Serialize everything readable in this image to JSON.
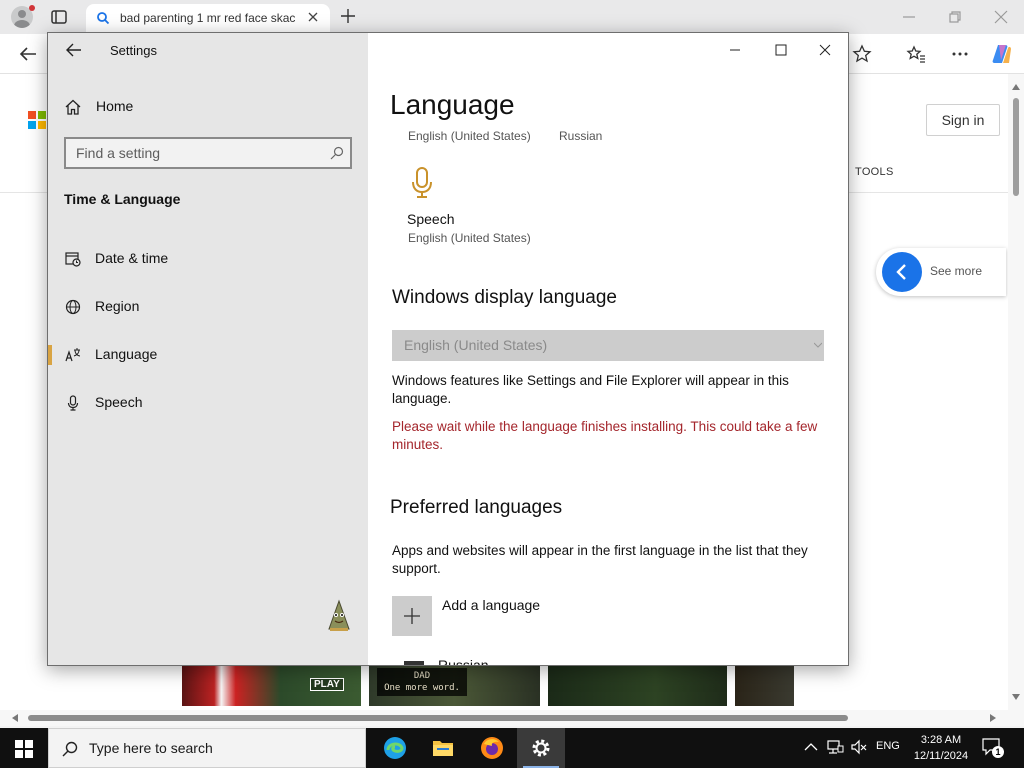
{
  "browser": {
    "tab_title": "bad parenting 1 mr red face skac",
    "colors": {
      "tab_search_icon": "#1a73e8",
      "copilot": "#5b5fdb"
    }
  },
  "webpage": {
    "signin_label": "Sign in",
    "tools_label": "TOOLS",
    "see_more_label": "See more",
    "thumb_play": "PLAY",
    "thumb_caption_line1": "DAD",
    "thumb_caption_line2": "One more word.",
    "ms_logo_colors": [
      "#f25022",
      "#7fba00",
      "#00a4ef",
      "#ffb900"
    ]
  },
  "settings": {
    "window_title": "Settings",
    "sidebar": {
      "home_label": "Home",
      "search_placeholder": "Find a setting",
      "section_heading": "Time & Language",
      "items": [
        {
          "label": "Date & time",
          "icon": "calendar-clock-icon",
          "selected": false
        },
        {
          "label": "Region",
          "icon": "globe-icon",
          "selected": false
        },
        {
          "label": "Language",
          "icon": "language-icon",
          "selected": true
        },
        {
          "label": "Speech",
          "icon": "microphone-icon",
          "selected": false
        }
      ],
      "accent": "#d9a443"
    },
    "main": {
      "title": "Language",
      "lang_chip_1": "English (United States)",
      "lang_chip_2": "Russian",
      "speech_title": "Speech",
      "speech_subtitle": "English (United States)",
      "display_heading": "Windows display language",
      "display_value": "English (United States)",
      "display_desc": "Windows features like Settings and File Explorer will appear in this language.",
      "warning": "Please wait while the language finishes installing. This could take a few minutes.",
      "preferred_heading": "Preferred languages",
      "preferred_desc": "Apps and websites will appear in the first language in the list that they support.",
      "add_language_label": "Add a language",
      "partial_lang_row": "Russian",
      "warning_color": "#a4262c"
    }
  },
  "taskbar": {
    "search_placeholder": "Type here to search",
    "language": "ENG",
    "time": "3:28 AM",
    "date": "12/11/2024",
    "notification_count": "1",
    "apps": [
      "edge-icon",
      "file-explorer-icon",
      "firefox-icon",
      "settings-gear-icon"
    ]
  }
}
